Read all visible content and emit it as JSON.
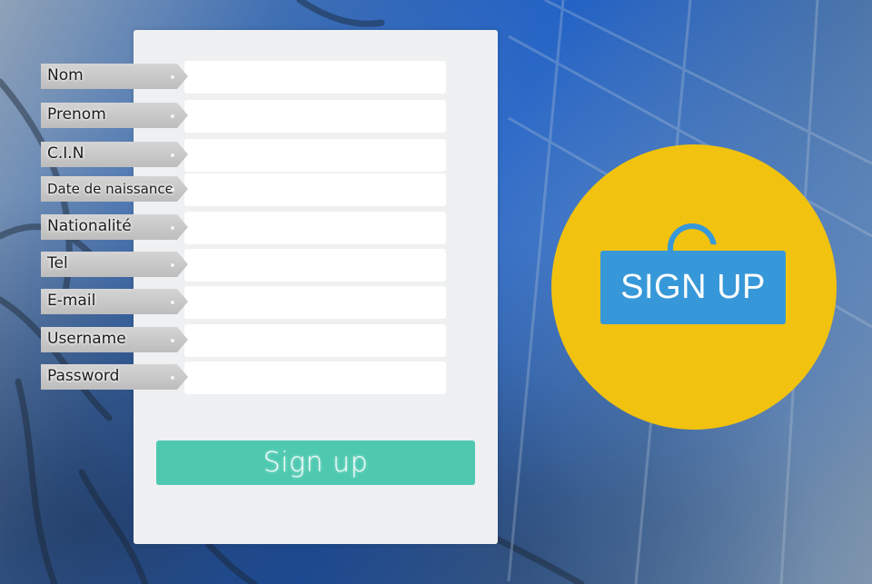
{
  "form": {
    "fields": [
      {
        "label": "Nom",
        "value": "",
        "placeholder": ""
      },
      {
        "label": "Prenom",
        "value": "",
        "placeholder": ""
      },
      {
        "label": "C.I.N",
        "value": "",
        "placeholder": ""
      },
      {
        "label": "Date de naissance",
        "value": "",
        "placeholder": ""
      },
      {
        "label": "Nationalité",
        "value": "",
        "placeholder": ""
      },
      {
        "label": "Tel",
        "value": "",
        "placeholder": ""
      },
      {
        "label": "E-mail",
        "value": "",
        "placeholder": ""
      },
      {
        "label": "Username",
        "value": "",
        "placeholder": ""
      },
      {
        "label": "Password",
        "value": "",
        "placeholder": ""
      }
    ],
    "submit_label": "Sign up"
  },
  "badge": {
    "icon": "padlock-icon",
    "text": "SIGN UP"
  },
  "colors": {
    "panel": "#eef0f2",
    "submit": "#4ec9b0",
    "badge_circle": "#f1c20f",
    "lock": "#3798d9",
    "tag": "#c8c8c8"
  }
}
